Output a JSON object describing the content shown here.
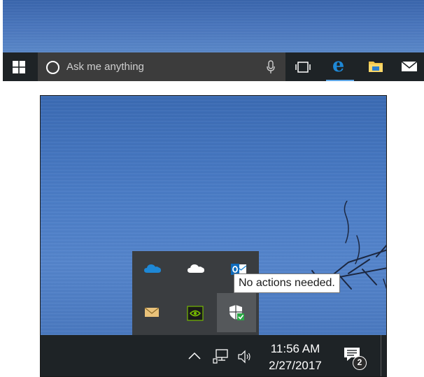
{
  "top_taskbar": {
    "search_placeholder": "Ask me anything",
    "icons": {
      "start": "windows-logo-icon",
      "cortana": "cortana-ring-icon",
      "microphone": "microphone-icon",
      "task_view": "task-view-icon",
      "edge": "edge-browser-icon",
      "file_explorer": "folder-icon",
      "mail": "mail-icon"
    },
    "edge_glyph": "e"
  },
  "tray_overflow": {
    "icons": [
      {
        "name": "onedrive-blue-icon"
      },
      {
        "name": "onedrive-white-icon"
      },
      {
        "name": "outlook-icon"
      },
      {
        "name": "envelope-icon"
      },
      {
        "name": "nvidia-icon"
      },
      {
        "name": "windows-defender-icon",
        "selected": true
      }
    ],
    "tooltip": "No actions needed."
  },
  "bottom_taskbar": {
    "time": "11:56 AM",
    "date": "2/27/2017",
    "notification_count": "2",
    "icons": {
      "overflow": "chevron-up-icon",
      "network": "network-icon",
      "volume": "speaker-icon",
      "action_center": "action-center-icon"
    }
  },
  "colors": {
    "taskbar": "#1e2326",
    "search_box": "#3c3c3c",
    "tray_flyout": "#3a3d40",
    "accent_blue": "#1e88d6",
    "defender_green": "#2aa745"
  }
}
